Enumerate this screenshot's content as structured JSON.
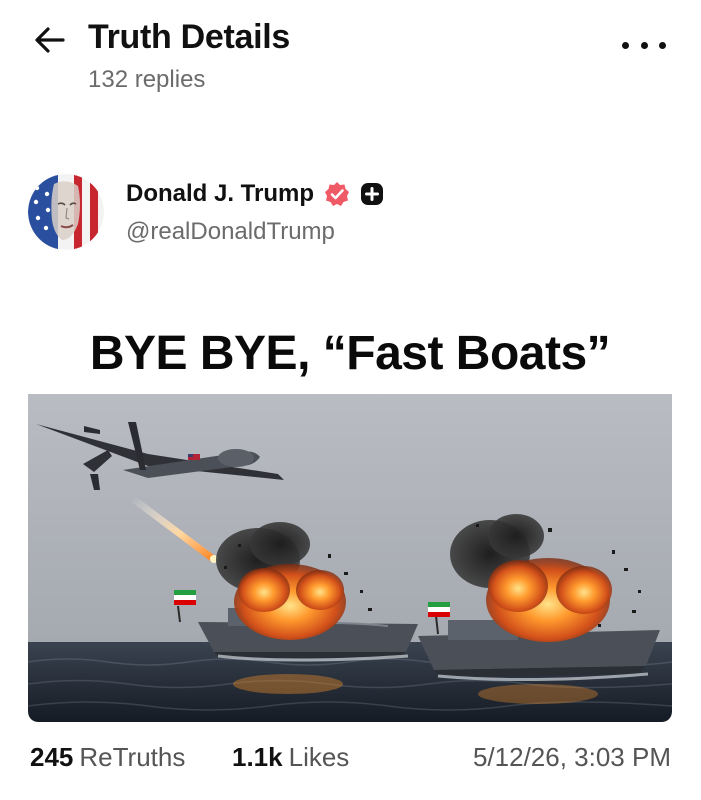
{
  "header": {
    "title": "Truth Details",
    "subtitle": "132 replies",
    "back_icon": "arrow-left-icon",
    "more_icon": "more-horizontal-icon"
  },
  "author": {
    "name": "Donald J. Trump",
    "handle": "@realDonaldTrump",
    "verified_icon": "verified-badge-icon",
    "plus_icon": "plus-badge-icon",
    "verified_color": "#f05a67"
  },
  "post": {
    "image_caption": "BYE BYE, “Fast Boats”"
  },
  "stats": {
    "retruths_count": "245",
    "retruths_label": "ReTruths",
    "likes_count": "1.1k",
    "likes_label": "Likes",
    "timestamp": "5/12/26, 3:03 PM"
  }
}
